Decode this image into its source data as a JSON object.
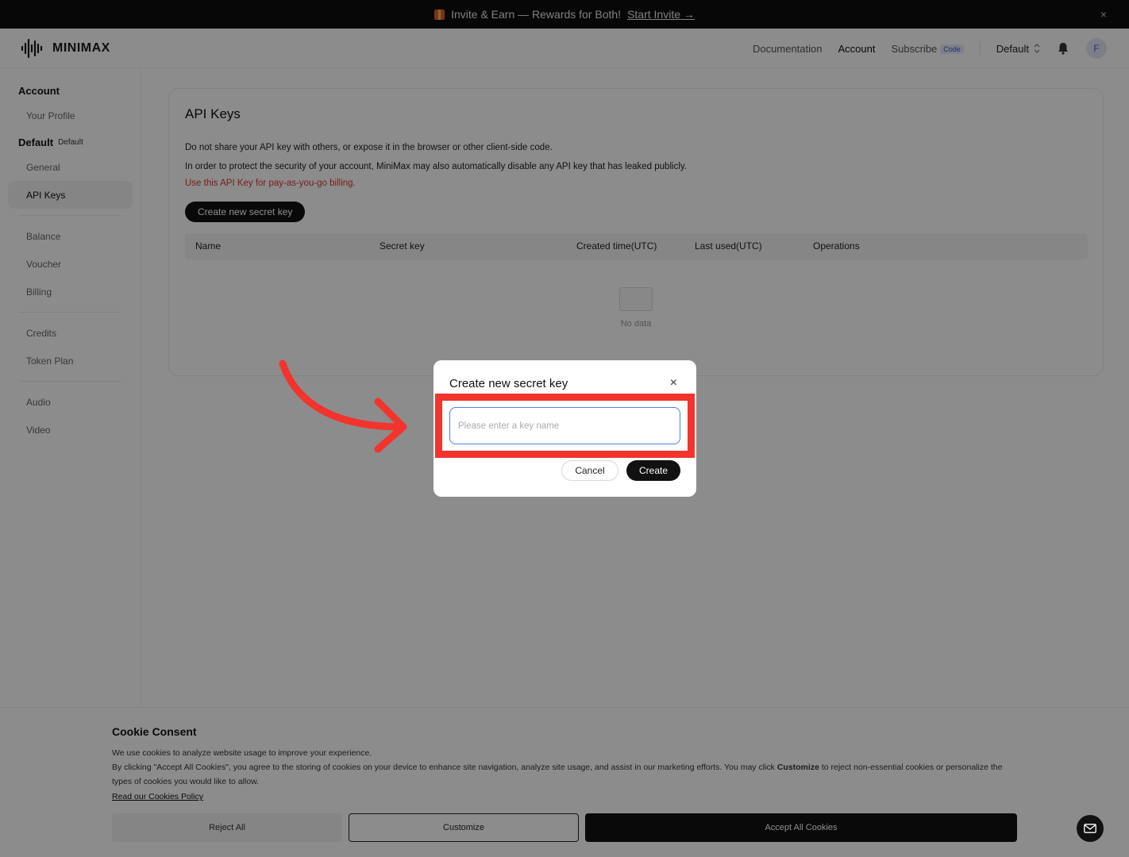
{
  "promo": {
    "text": "Invite & Earn — Rewards for Both!",
    "link": "Start Invite →",
    "close": "×"
  },
  "header": {
    "logo": "MINIMAX",
    "nav": {
      "documentation": "Documentation",
      "account": "Account",
      "subscribe": "Subscribe",
      "code_badge": "Code"
    },
    "project_select": "Default",
    "avatar_initial": "F"
  },
  "sidebar": {
    "account_head": "Account",
    "your_profile": "Your Profile",
    "default_head": "Default",
    "default_tag": "Default",
    "items": [
      "General",
      "API Keys",
      "Balance",
      "Voucher",
      "Billing",
      "Credits",
      "Token Plan",
      "Audio",
      "Video"
    ]
  },
  "main": {
    "title": "API Keys",
    "line1": "Do not share your API key with others, or expose it in the browser or other client-side code.",
    "line2": "In order to protect the security of your account, MiniMax may also automatically disable any API key that has leaked publicly.",
    "line3": "Use this API Key for pay-as-you-go billing.",
    "create_button": "Create new secret key",
    "columns": [
      "Name",
      "Secret key",
      "Created time(UTC)",
      "Last used(UTC)",
      "Operations"
    ],
    "empty_text": "No data"
  },
  "modal": {
    "title": "Create new secret key",
    "close": "×",
    "input_placeholder": "Please enter a key name",
    "cancel": "Cancel",
    "create": "Create"
  },
  "cookie": {
    "title": "Cookie Consent",
    "line1": "We use cookies to analyze website usage to improve your experience.",
    "line2_a": "By clicking \"Accept All Cookies\", you agree to the storing of cookies on your device to enhance site navigation, analyze site usage, and assist in our marketing efforts. You may click ",
    "line2_b": "Customize",
    "line2_c": " to reject non-essential cookies or personalize the types of cookies you would like to allow.",
    "policy_link": "Read our Cookies Policy",
    "reject": "Reject All",
    "customize": "Customize",
    "accept": "Accept All Cookies"
  },
  "colors": {
    "highlight": "#f2342c",
    "arrow": "#f2342c",
    "input_border": "#4d7ee8",
    "warning_text": "#e0362d"
  }
}
